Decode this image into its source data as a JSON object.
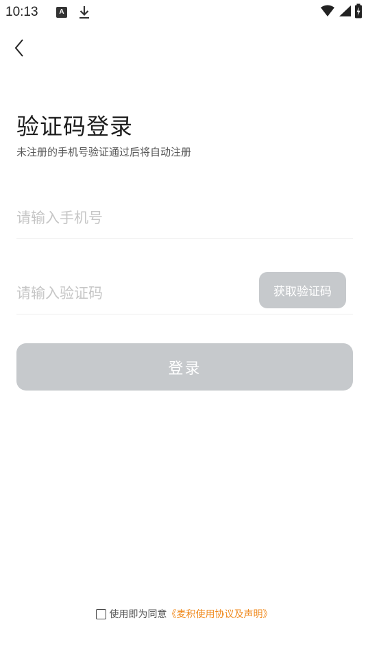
{
  "status_bar": {
    "time": "10:13",
    "notification_icon_letter": "A",
    "icons": [
      "a-badge-icon",
      "download-icon",
      "wifi-icon",
      "signal-icon",
      "battery-charging-icon"
    ]
  },
  "header": {
    "back_icon": "chevron-left-icon"
  },
  "login": {
    "title": "验证码登录",
    "subtitle": "未注册的手机号验证通过后将自动注册",
    "phone_placeholder": "请输入手机号",
    "phone_value": "",
    "code_placeholder": "请输入验证码",
    "code_value": "",
    "get_code_label": "获取验证码",
    "login_label": "登录"
  },
  "agreement": {
    "checked": false,
    "text": "使用即为同意",
    "link_text": "《麦积使用协议及声明》"
  },
  "colors": {
    "background": "#ffffff",
    "button_disabled": "#c6c9cc",
    "button_text": "#ffffff",
    "placeholder": "#c6c6c6",
    "link": "#f08a1d",
    "title": "#1d1d1d"
  }
}
